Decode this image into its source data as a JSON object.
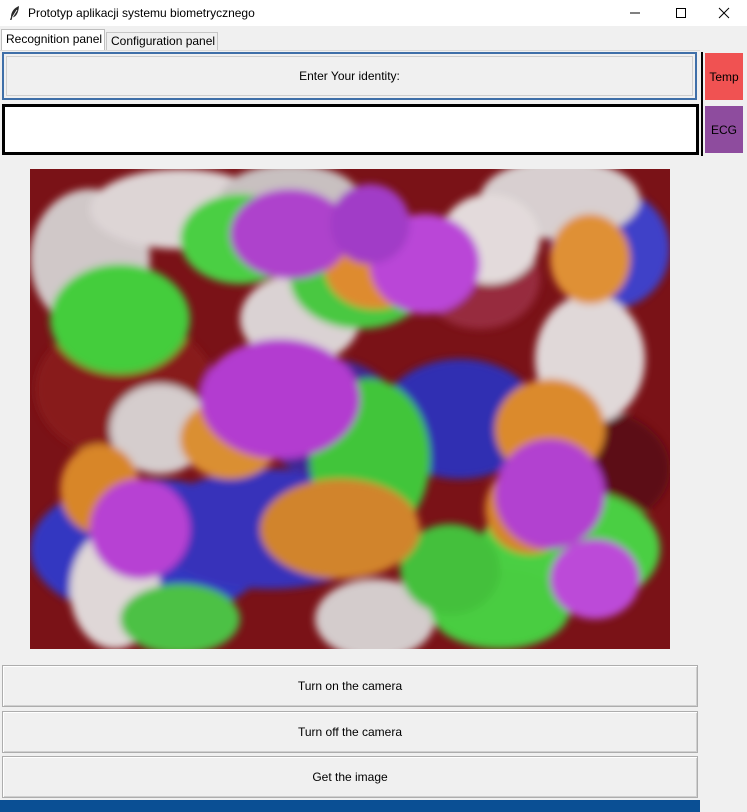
{
  "window": {
    "title": "Prototyp aplikacji systemu biometrycznego",
    "icon": "feather-icon",
    "controls": [
      "minimize-icon",
      "maximize-icon",
      "close-icon"
    ]
  },
  "tabs": [
    {
      "label": "Recognition panel",
      "active": true
    },
    {
      "label": "Configuration panel",
      "active": false
    }
  ],
  "identity": {
    "prompt_label": "Enter Your identity:",
    "input_value": ""
  },
  "side_buttons": {
    "temp": {
      "label": "Temp",
      "color": "#f05252"
    },
    "ecg": {
      "label": "ECG",
      "color": "#8e4c9e"
    }
  },
  "camera": {
    "image": "camera-preview-abstract-blobs",
    "colors": [
      "#7a1217",
      "#2f3bd0",
      "#3fdd3f",
      "#e0902c",
      "#b83fe0",
      "#ebebeb"
    ]
  },
  "actions": {
    "turn_on": "Turn on the camera",
    "turn_off": "Turn off the camera",
    "get_image": "Get the image"
  },
  "colors": {
    "focus_border": "#3f6fa8",
    "bottom_bar": "#0a4f94"
  }
}
